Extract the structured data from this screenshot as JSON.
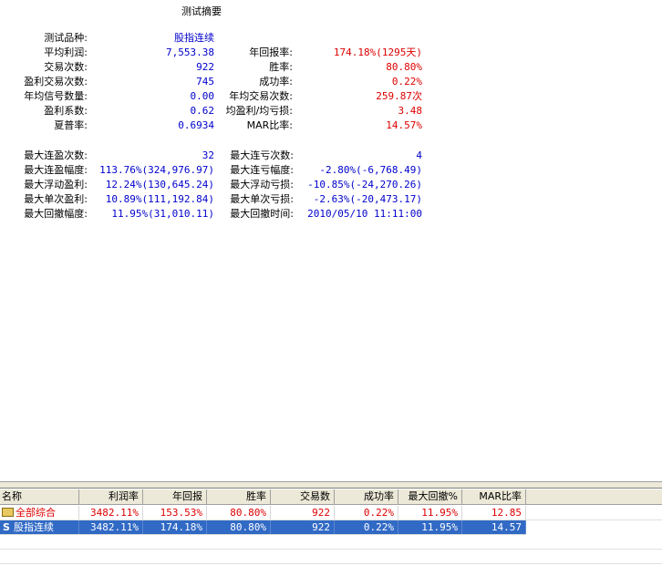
{
  "summary": {
    "title": "测试摘要",
    "left_block": [
      {
        "label": "测试品种:",
        "value": "股指连续"
      },
      {
        "label": "平均利润:",
        "value": "7,553.38"
      },
      {
        "label": "交易次数:",
        "value": "922"
      },
      {
        "label": "盈利交易次数:",
        "value": "745"
      },
      {
        "label": "年均信号数量:",
        "value": "0.00"
      },
      {
        "label": "盈利系数:",
        "value": "0.62"
      },
      {
        "label": "夏普率:",
        "value": "0.6934"
      }
    ],
    "right_block": [
      {
        "label": "年回报率:",
        "value": "174.18%(1295天)"
      },
      {
        "label": "胜率:",
        "value": "80.80%"
      },
      {
        "label": "成功率:",
        "value": "0.22%"
      },
      {
        "label": "年均交易次数:",
        "value": "259.87次"
      },
      {
        "label": "均盈利/均亏损:",
        "value": "3.48"
      },
      {
        "label": "MAR比率:",
        "value": "14.57%"
      }
    ],
    "left_block2": [
      {
        "label": "最大连盈次数:",
        "value": "32"
      },
      {
        "label": "最大连盈幅度:",
        "value": "113.76%(324,976.97)"
      },
      {
        "label": "最大浮动盈利:",
        "value": "12.24%(130,645.24)"
      },
      {
        "label": "最大单次盈利:",
        "value": "10.89%(111,192.84)"
      },
      {
        "label": "最大回撤幅度:",
        "value": "11.95%(31,010.11)"
      }
    ],
    "right_block2": [
      {
        "label": "最大连亏次数:",
        "value": "4"
      },
      {
        "label": "最大连亏幅度:",
        "value": "-2.80%(-6,768.49)"
      },
      {
        "label": "最大浮动亏损:",
        "value": "-10.85%(-24,270.26)"
      },
      {
        "label": "最大单次亏损:",
        "value": "-2.63%(-20,473.17)"
      },
      {
        "label": "最大回撤时间:",
        "value": "2010/05/10 11:11:00"
      }
    ]
  },
  "table": {
    "headers": [
      "名称",
      "利润率",
      "年回报",
      "胜率",
      "交易数",
      "成功率",
      "最大回撤%",
      "MAR比率"
    ],
    "rows": [
      {
        "name": "全部综合",
        "icon": "folder-icon",
        "values": [
          "3482.11%",
          "153.53%",
          "80.80%",
          "922",
          "0.22%",
          "11.95%",
          "12.85"
        ]
      },
      {
        "name": "股指连续",
        "icon": "strategy-s-icon",
        "icon_char": "S",
        "values": [
          "3482.11%",
          "174.18%",
          "80.80%",
          "922",
          "0.22%",
          "11.95%",
          "14.57"
        ]
      }
    ]
  },
  "colors": {
    "value_blue": "#0000cc",
    "value_red": "#dd0000",
    "selection": "#316ac5"
  }
}
